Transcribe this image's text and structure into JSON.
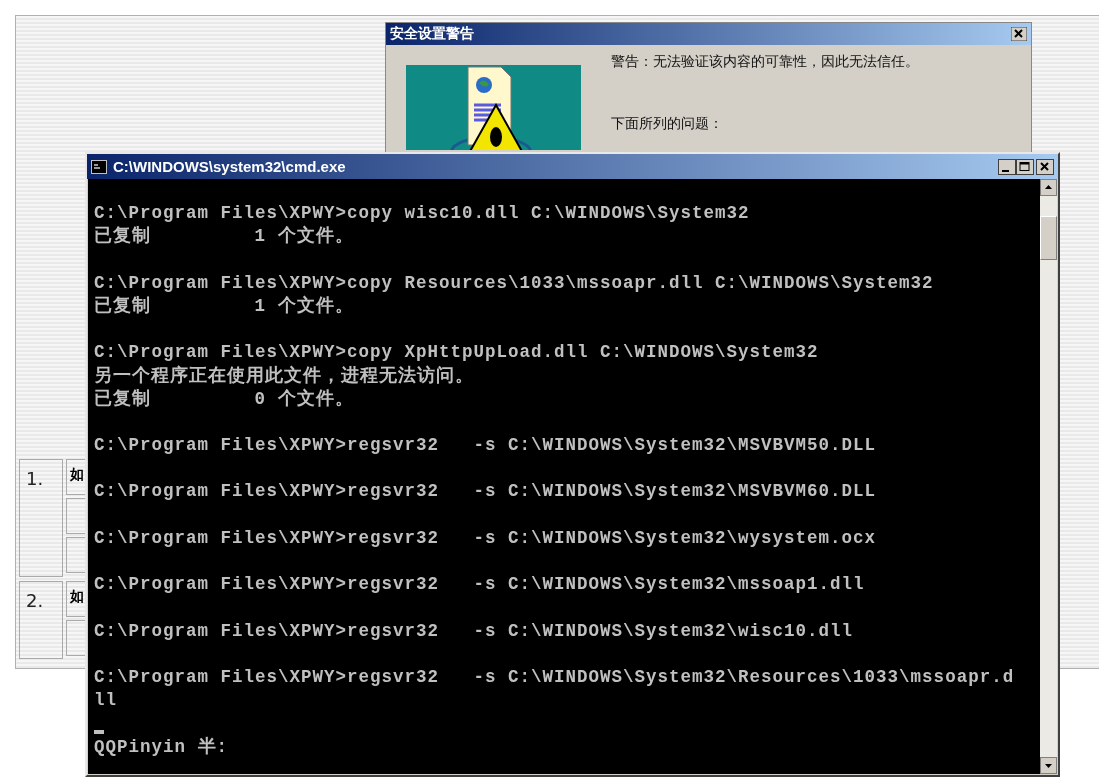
{
  "page": {
    "rows": [
      {
        "number": "1.",
        "cell": "如"
      },
      {
        "number": "2.",
        "cell": "如"
      }
    ]
  },
  "security_dialog": {
    "title": "安全设置警告",
    "warning": "警告：无法验证该内容的可靠性，因此无法信任。",
    "problems_heading": "下面所列的问题："
  },
  "console_window": {
    "title": "C:\\WINDOWS\\system32\\cmd.exe",
    "blocks": [
      [
        "C:\\Program Files\\XPWY>copy wisc10.dll C:\\WINDOWS\\System32",
        "已复制         1 个文件。"
      ],
      [
        "C:\\Program Files\\XPWY>copy Resources\\1033\\mssoapr.dll C:\\WINDOWS\\System32",
        "已复制         1 个文件。"
      ],
      [
        "C:\\Program Files\\XPWY>copy XpHttpUpLoad.dll C:\\WINDOWS\\System32",
        "另一个程序正在使用此文件，进程无法访问。",
        "已复制         0 个文件。"
      ],
      [
        "C:\\Program Files\\XPWY>regsvr32   -s C:\\WINDOWS\\System32\\MSVBVM50.DLL"
      ],
      [
        "C:\\Program Files\\XPWY>regsvr32   -s C:\\WINDOWS\\System32\\MSVBVM60.DLL"
      ],
      [
        "C:\\Program Files\\XPWY>regsvr32   -s C:\\WINDOWS\\System32\\wysystem.ocx"
      ],
      [
        "C:\\Program Files\\XPWY>regsvr32   -s C:\\WINDOWS\\System32\\mssoap1.dll"
      ],
      [
        "C:\\Program Files\\XPWY>regsvr32   -s C:\\WINDOWS\\System32\\wisc10.dll"
      ],
      [
        "C:\\Program Files\\XPWY>regsvr32   -s C:\\WINDOWS\\System32\\Resources\\1033\\mssoapr.d",
        "ll"
      ]
    ],
    "ime_status": "QQPinyin 半:"
  }
}
